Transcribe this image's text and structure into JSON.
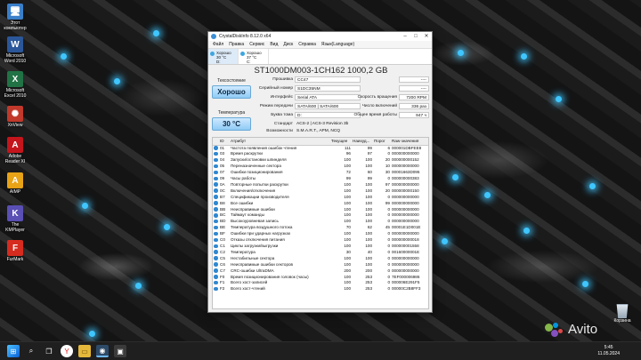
{
  "desktop": {
    "icons": [
      {
        "label": "Этот\nкомпьютер",
        "glyph": "🖥",
        "color": "#3a7fc9"
      },
      {
        "label": "Microsoft\nWord 2010",
        "glyph": "W",
        "color": "#2b579a"
      },
      {
        "label": "Microsoft\nExcel 2010",
        "glyph": "X",
        "color": "#217346"
      },
      {
        "label": "XnView",
        "glyph": "✺",
        "color": "#c0392b"
      },
      {
        "label": "Adobe\nReader XI",
        "glyph": "A",
        "color": "#c4151c"
      },
      {
        "label": "AIMP",
        "glyph": "A",
        "color": "#e8a317"
      },
      {
        "label": "The KMPlayer",
        "glyph": "K",
        "color": "#5a4fb5"
      },
      {
        "label": "FurMark",
        "glyph": "F",
        "color": "#d62b1f"
      }
    ],
    "recycle_label": "Корзина"
  },
  "window": {
    "title": "CrystalDiskInfo 8.12.0 x64",
    "menu": [
      "Файл",
      "Правка",
      "Сервис",
      "Вид",
      "Диск",
      "Справка",
      "Язык(Language)"
    ],
    "drives": [
      {
        "status": "Хорошо",
        "temp": "30 °C",
        "letter": "D:"
      },
      {
        "status": "Хорошо",
        "temp": "37 °C",
        "letter": "C:"
      }
    ],
    "model": "ST1000DM003-1CH162 1000,2 GB",
    "health_label": "Техсостояние",
    "health_value": "Хорошо",
    "temp_label": "Температура",
    "temp_value": "30 °C",
    "left_fields": [
      {
        "label": "Прошивка",
        "value": "CC47"
      },
      {
        "label": "Серийный номер",
        "value": "S1DC35NM"
      },
      {
        "label": "Интерфейс",
        "value": "Serial ATA"
      },
      {
        "label": "Режим передачи",
        "value": "SATA/600 | SATA/600"
      },
      {
        "label": "Буква тома",
        "value": "D:"
      }
    ],
    "right_fields": [
      {
        "label": "",
        "value": "----"
      },
      {
        "label": "",
        "value": "----"
      },
      {
        "label": "Скорость вращения",
        "value": "7200 RPM"
      },
      {
        "label": "Число включений",
        "value": "336 раз"
      },
      {
        "label": "Общее время работы",
        "value": "947 ч"
      }
    ],
    "standard_label": "Стандарт",
    "standard_value": "ACS-2 | ACS-3 Revision 3b",
    "features_label": "Возможности",
    "features_value": "S.M.A.R.T., APM, NCQ",
    "smart_headers": [
      "ID",
      "Атрибут",
      "Текущее",
      "Наихуд...",
      "Порог",
      "Raw-значения"
    ],
    "smart_rows": [
      [
        "01",
        "Частота появления ошибок чтения",
        "111",
        "99",
        "6",
        "000001DBFEE8"
      ],
      [
        "03",
        "Время раскрутки",
        "96",
        "97",
        "0",
        "000000000000"
      ],
      [
        "04",
        "Запуски/остановки шпинделя",
        "100",
        "100",
        "20",
        "000000000152"
      ],
      [
        "05",
        "Переназначенные сектора",
        "100",
        "100",
        "10",
        "000000000000"
      ],
      [
        "07",
        "Ошибки позиционирования",
        "72",
        "60",
        "30",
        "00001663D095"
      ],
      [
        "09",
        "Часы работы",
        "99",
        "99",
        "0",
        "000000000383"
      ],
      [
        "0A",
        "Повторные попытки раскрутки",
        "100",
        "100",
        "97",
        "000000000000"
      ],
      [
        "0C",
        "Включения/отключения",
        "100",
        "100",
        "20",
        "000000000150"
      ],
      [
        "B7",
        "Спецификации производителя",
        "100",
        "100",
        "0",
        "000000000000"
      ],
      [
        "B8",
        "Все ошибки",
        "100",
        "100",
        "99",
        "000000000000"
      ],
      [
        "BB",
        "Неисправимые ошибки",
        "100",
        "100",
        "0",
        "000000000000"
      ],
      [
        "BC",
        "Таймаут команды",
        "100",
        "100",
        "0",
        "000000000000"
      ],
      [
        "BD",
        "Высокоуровневая запись",
        "100",
        "100",
        "0",
        "000000000000"
      ],
      [
        "BE",
        "Температура воздушного потока",
        "70",
        "62",
        "45",
        "00001E1D001E"
      ],
      [
        "BF",
        "Ошибки при ударных нагрузках",
        "100",
        "100",
        "0",
        "000000000000"
      ],
      [
        "C0",
        "Отказы отключения питания",
        "100",
        "100",
        "0",
        "000000000018"
      ],
      [
        "C1",
        "Циклы загрузки/выгрузки",
        "100",
        "100",
        "0",
        "000000001558"
      ],
      [
        "C2",
        "Температура",
        "30",
        "40",
        "0",
        "00160000001E"
      ],
      [
        "C5",
        "Нестабильные сектора",
        "100",
        "100",
        "0",
        "000000000000"
      ],
      [
        "C6",
        "Неисправимые ошибки секторов",
        "100",
        "100",
        "0",
        "000000000000"
      ],
      [
        "C7",
        "CRC-ошибки UltraDMA",
        "200",
        "200",
        "0",
        "000000000000"
      ],
      [
        "F0",
        "Время позиционирования головок (часы)",
        "100",
        "253",
        "0",
        "7EF000006986"
      ],
      [
        "F1",
        "Всего хост-записей",
        "100",
        "253",
        "0",
        "000006E291F5"
      ],
      [
        "F2",
        "Всего хост-чтений",
        "100",
        "253",
        "0",
        "00000C2B8FF3"
      ]
    ]
  },
  "taskbar": {
    "time": "5:45",
    "date": "11.05.2024"
  },
  "watermark": "Avito"
}
